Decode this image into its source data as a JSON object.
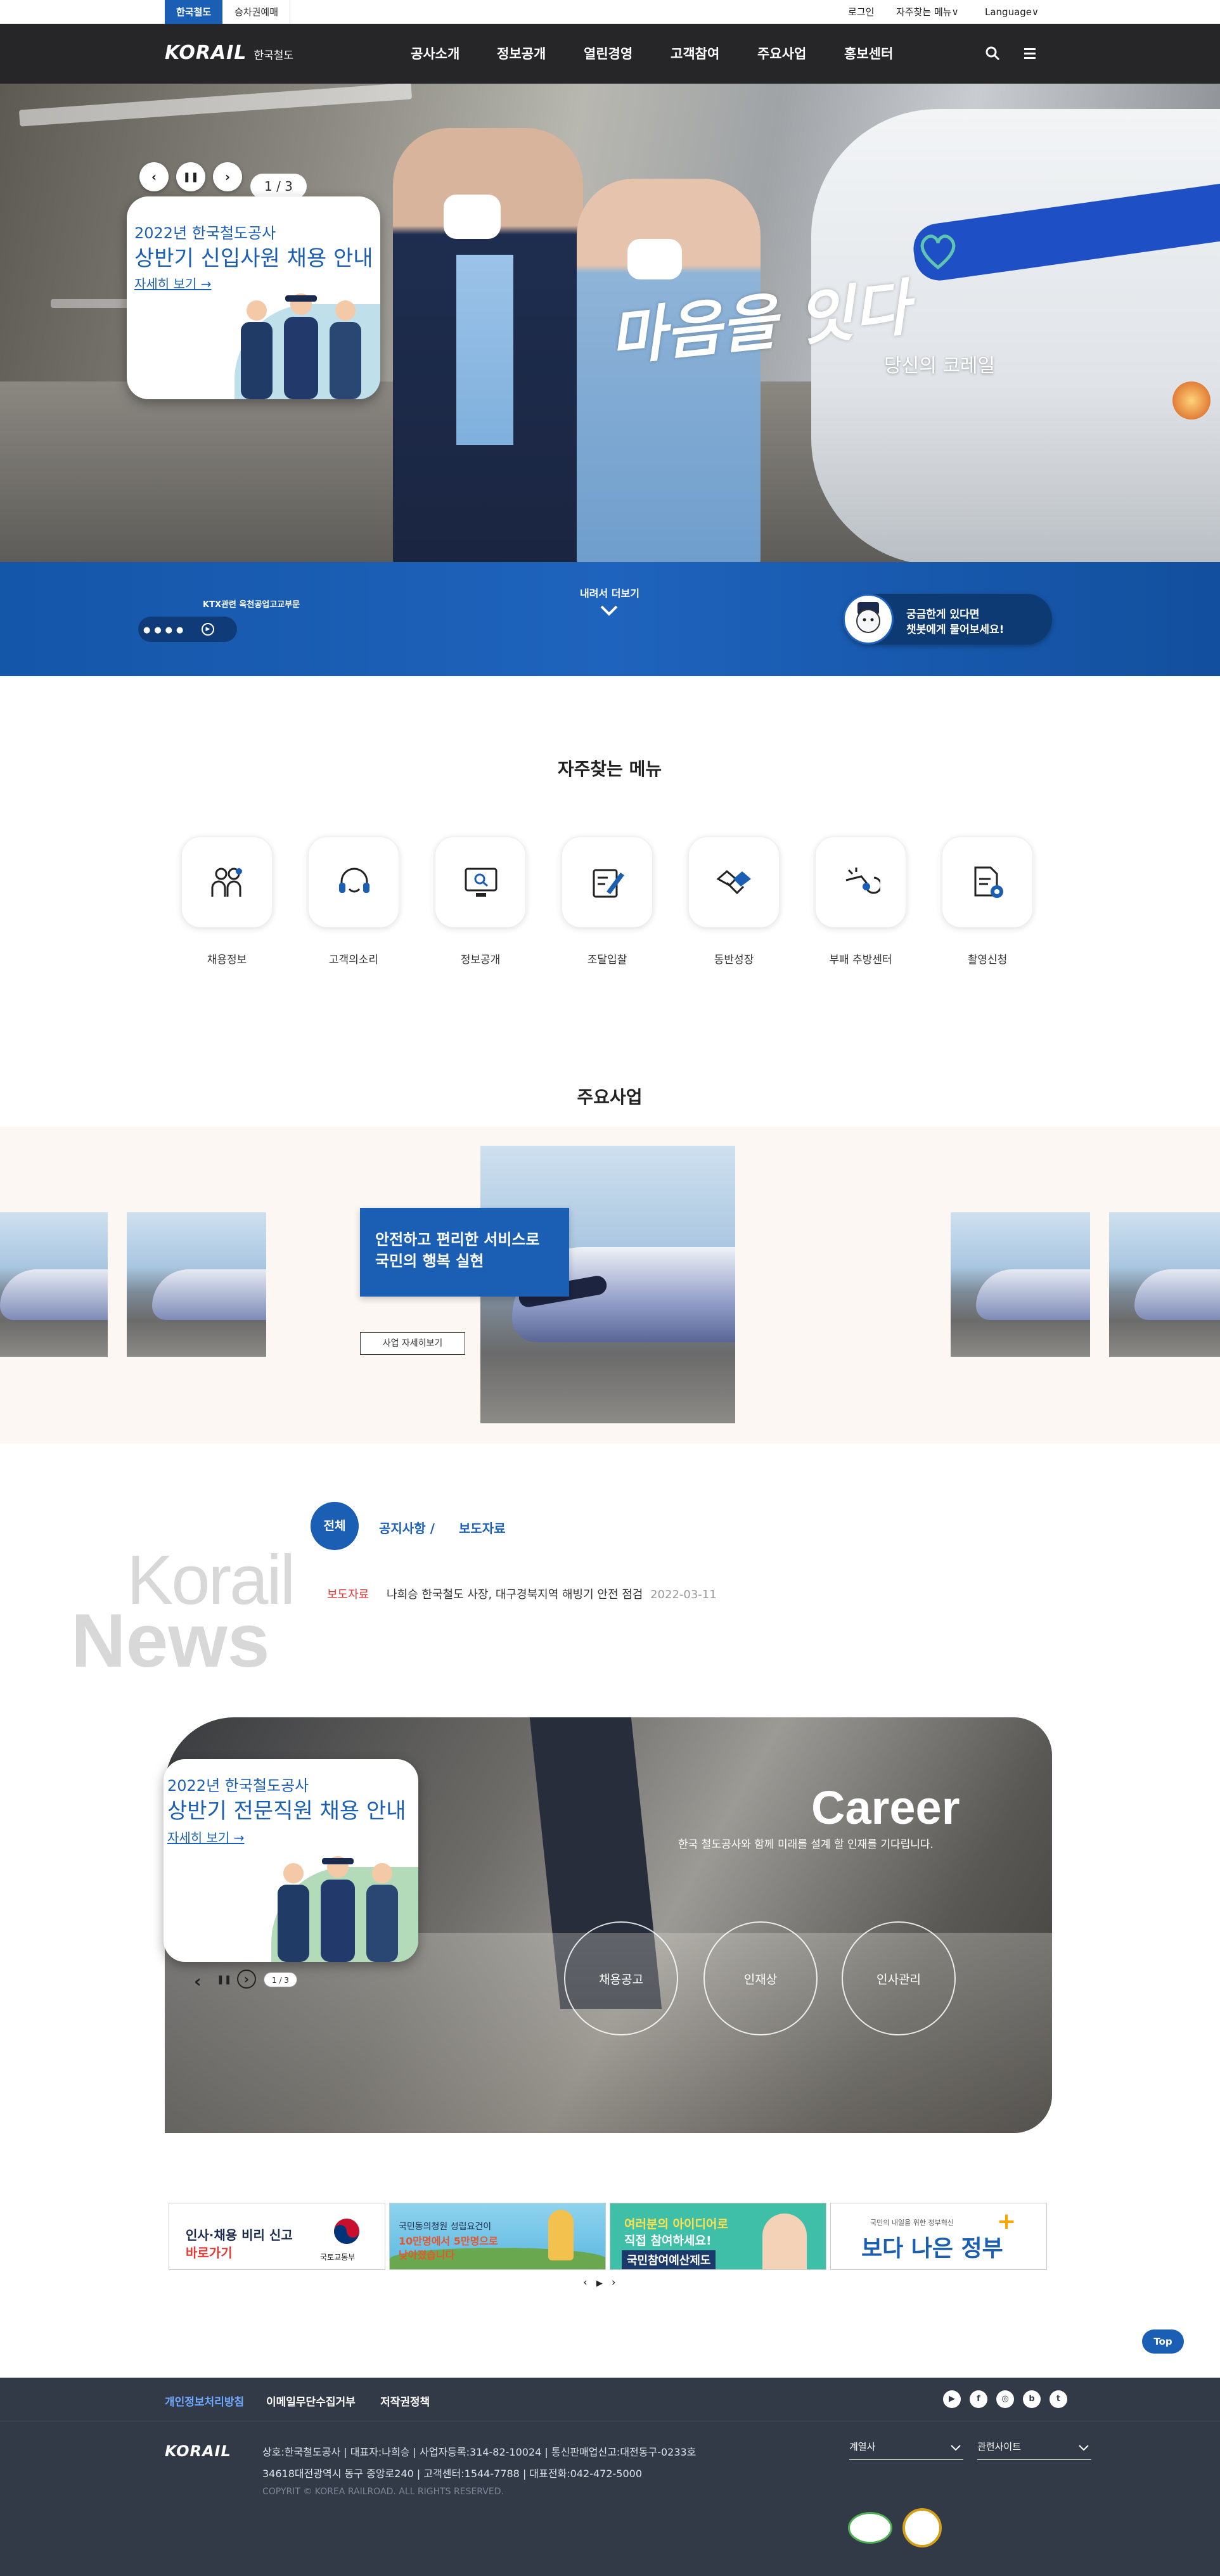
{
  "util_bar": {
    "tab_active": "한국철도",
    "tab_2": "승차권예매",
    "login": "로그인",
    "freq_menu": "자주찾는 메뉴∨",
    "language": "Language∨"
  },
  "header": {
    "logo": "KORAIL",
    "logo_sub": "한국철도",
    "nav": [
      "공사소개",
      "정보공개",
      "열린경영",
      "고객참여",
      "주요사업",
      "홍보센터"
    ]
  },
  "hero": {
    "page_indicator": "1 / 3",
    "popup": {
      "sub": "2022년 한국철도공사",
      "title": "상반기 신입사원 채용 안내",
      "link": "자세히 보기 →"
    },
    "slogan_main": "마음을 잇다",
    "slogan_sub": "당신의 코레일"
  },
  "blue_band": {
    "left_label": "KTX관련 옥천공업고교부문",
    "more_label": "내려서 더보기",
    "chatbot_line1": "궁금한게 있다면",
    "chatbot_line2": "챗봇에게 물어보세요!"
  },
  "freq_menu": {
    "title": "자주찾는 메뉴",
    "items": [
      "채용정보",
      "고객의소리",
      "정보공개",
      "조달입찰",
      "동반성장",
      "부패 추방센터",
      "촬영신청"
    ]
  },
  "business": {
    "title": "주요사업",
    "slide_text_1": "안전하고 편리한 서비스로",
    "slide_text_2": "국민의 행복 실현",
    "detail_button": "사업 자세히보기"
  },
  "news": {
    "bg_word_1": "Korail",
    "bg_word_2": "News",
    "tabs": [
      "전체",
      "공지사항 /",
      "보도자료"
    ],
    "item": {
      "category": "보도자료",
      "title": "나희승 한국철도 사장, 대구경북지역 해빙기 안전 점검",
      "date": "2022-03-11"
    }
  },
  "career": {
    "title": "Career",
    "subtitle": "한국 철도공사와 함께 미래를 설계 할 인재를 기다립니다.",
    "buttons": [
      "채용공고",
      "인재상",
      "인사관리"
    ],
    "popup": {
      "sub": "2022년 한국철도공사",
      "title": "상반기 전문직원 채용 안내",
      "link": "자세히 보기 →"
    },
    "page_indicator": "1 / 3"
  },
  "banners": {
    "b1_line1": "인사·채용 비리 신고",
    "b1_line2": "바로가기",
    "b1_org": "국토교통부",
    "b2_line1": "국민동의청원 성립요건이",
    "b2_line2": "10만명에서 5만명으로",
    "b2_line3": "낮아졌습니다",
    "b3_line1": "여러분의 아이디어로",
    "b3_line2": "직접 참여하세요!",
    "b3_line3": "국민참여예산제도",
    "b4_small": "국민의 내일을 위한 정부혁신",
    "b4_main": "보다 나은 정부"
  },
  "top_button": "Top",
  "footer": {
    "links": [
      "개인정보처리방침",
      "이메일무단수집거부",
      "저작권정책"
    ],
    "logo": "KORAIL",
    "info_line1": "상호:한국철도공사 | 대표자:나희승 | 사업자등록:314-82-10024 | 통신판매업신고:대전동구-0233호",
    "info_line2": "34618대전광역시 동구 중앙로240 | 고객센터:1544-7788 | 대표전화:042-472-5000",
    "copyright": "COPYRIT © KOREA RAILROAD. ALL RIGHTS RESERVED.",
    "select_1": "계열사",
    "select_2": "관련사이트",
    "sns": [
      "▶",
      "f",
      "◎",
      "b",
      "t"
    ]
  },
  "colors": {
    "brand_blue": "#1b5fb4",
    "footer_bg": "#323a48",
    "category_red": "#e53935"
  }
}
